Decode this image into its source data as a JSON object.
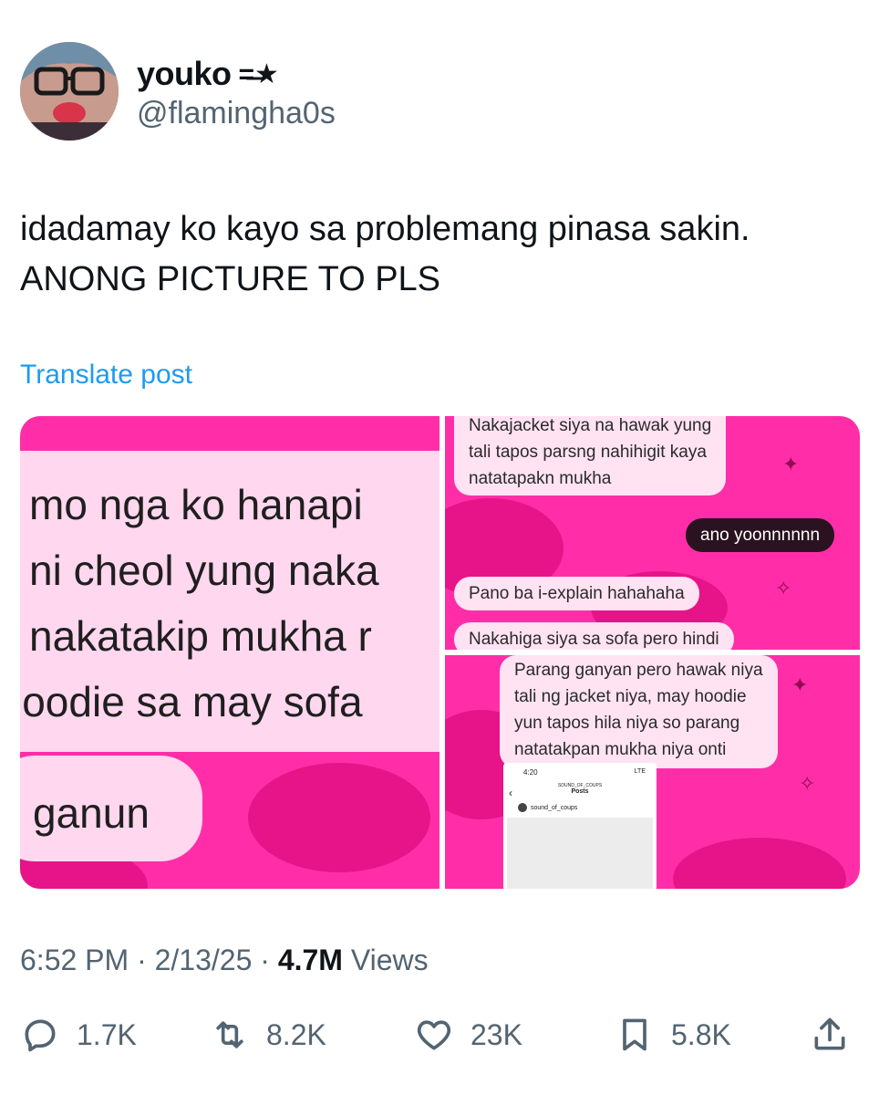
{
  "author": {
    "display_name": "youko",
    "name_decoration": "=̶★",
    "handle": "@flamingha0s"
  },
  "tweet": {
    "text_lines": [
      "idadamay ko kayo sa problemang pinasa sakin.",
      "ANONG PICTURE TO PLS"
    ],
    "translate_label": "Translate post"
  },
  "media": {
    "left_panel": {
      "lines": [
        "mo nga ko hanapi",
        "ni cheol yung naka",
        "nakatakip mukha r",
        "ioodie sa may sofa"
      ],
      "reply": "ganun"
    },
    "top_right": {
      "bubble_1": [
        "Nakajacket siya na hawak yung",
        "tali tapos parsng nahihigit kaya",
        "natatapakn mukha"
      ],
      "dark_bubble": "ano yoonnnnnn",
      "bubble_2": "Pano ba i-explain hahahaha",
      "bubble_3": "Nakahiga siya sa sofa pero hindi"
    },
    "bottom_right": {
      "bubble": [
        "Parang ganyan pero hawak niya",
        "tali ng jacket niya, may hoodie",
        "yun tapos hila niya so parang",
        "natatakpan mukha niya onti"
      ],
      "phone": {
        "time": "4:20",
        "status": "LTE",
        "account_small": "SOUND_OF_COUPS",
        "title": "Posts",
        "username": "sound_of_coups"
      }
    }
  },
  "meta": {
    "time": "6:52 PM",
    "sep1": " · ",
    "date": "2/13/25",
    "sep2": " · ",
    "views_count": "4.7M",
    "views_label": " Views"
  },
  "actions": {
    "replies": "1.7K",
    "reposts": "8.2K",
    "likes": "23K",
    "bookmarks": "5.8K"
  }
}
